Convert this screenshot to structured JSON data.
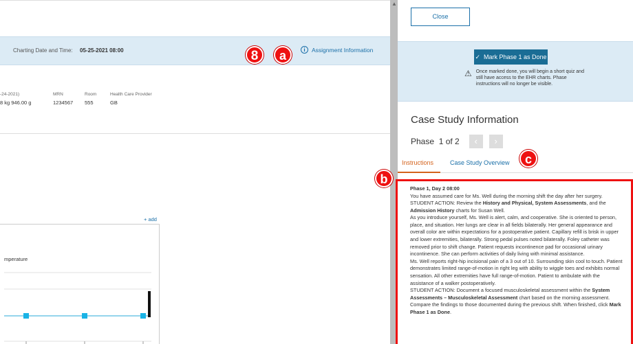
{
  "left": {
    "charting": {
      "label": "Charting Date and Time:",
      "value": "05-25-2021 08:00"
    },
    "assignment_info": "Assignment Information",
    "markers": {
      "m8": "8",
      "ma": "a",
      "mb": "b",
      "mc": "c"
    },
    "patient": {
      "dob_fragment": "-24-2021)",
      "weight_fragment": "8 kg 946.00 g",
      "mrn_label": "MRN",
      "mrn_value": "1234567",
      "room_label": "Room",
      "room_value": "555",
      "provider_label": "Health Care Provider",
      "provider_value": "GB"
    },
    "add_link": "+ add",
    "chart_title_fragment": "mperature"
  },
  "chart_data": {
    "type": "line",
    "title": "mperature",
    "series": [
      {
        "values": [
          1,
          1,
          1
        ]
      }
    ],
    "colors": {
      "line": "#2aa8d8",
      "marker": "#19b3e6"
    }
  },
  "right": {
    "close_label": "Close",
    "mark_done_label": "Mark Phase 1 as Done",
    "mark_done_icon": "check-icon",
    "warning_icon": "warning-icon",
    "warning_text": "Once marked done, you will begin a short quiz and still have access to the EHR charts. Phase instructions will no longer be visible.",
    "case_study_title": "Case Study Information",
    "phase_text": "Phase  1 of 2",
    "tabs": {
      "instructions": "Instructions",
      "overview": "Case Study Overview"
    },
    "instructions": {
      "heading": "Phase 1, Day 2 08:00",
      "p1": "You have assumed care for Ms. Well during the morning shift the day after her surgery.",
      "p2_prefix": "STUDENT ACTION: Review the ",
      "p2_bold1": "History and Physical, System Assessments",
      "p2_mid": ", and the ",
      "p2_bold2": "Admission History",
      "p2_suffix": " charts for Susan Well.",
      "p3": "As you introduce yourself, Ms. Well is alert, calm, and cooperative. She is oriented to person, place, and situation. Her lungs are clear in all fields bilaterally. Her general appearance and overall color are within expectations for a postoperative patient. Capillary refill is brisk in upper and lower extremities, bilaterally. Strong pedal pulses noted bilaterally. Foley catheter was removed prior to shift change. Patient requests incontinence pad for occasional urinary incontinence. She can perform activities of daily living with minimal assistance.",
      "p4": "Ms. Well reports right-hip incisional pain of a 3 out of 10. Surrounding skin cool to touch. Patient demonstrates limited range-of-motion in right leg with ability to wiggle toes and exhibits normal sensation. All other extremities have full range-of-motion. Patient to ambulate with the assistance of a walker postoperatively.",
      "p5_prefix": "STUDENT ACTION: Document a focused musculoskeletal assessment within the ",
      "p5_bold1": "System Assessments – Musculoskeletal Assessment",
      "p5_mid": " chart based on the morning assessment. Compare the findings to those documented during the previous shift. When finished, click ",
      "p5_bold2": "Mark Phase 1 as Done",
      "p5_suffix": "."
    }
  }
}
